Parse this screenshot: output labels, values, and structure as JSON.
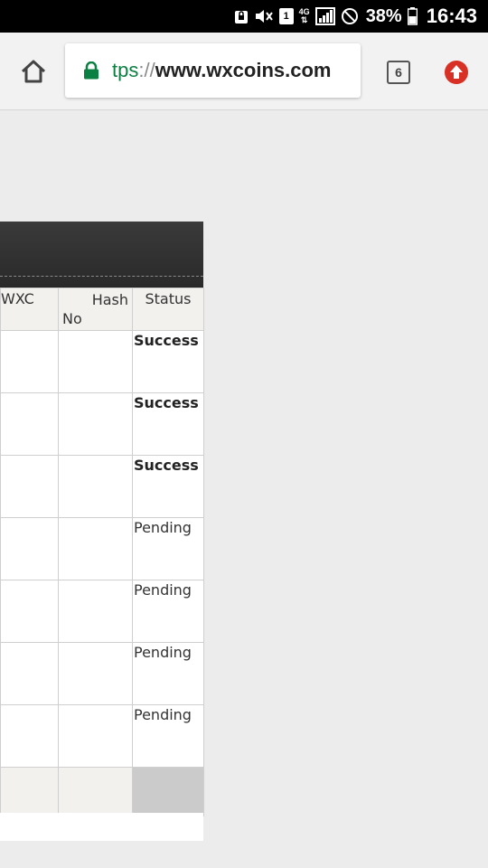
{
  "status_bar": {
    "network": "4G",
    "sim_slot": "1",
    "battery_percent": "38%",
    "time": "16:43",
    "icons": [
      "lock-notification-icon",
      "mute-icon",
      "sim-icon",
      "signal-icon",
      "do-not-disturb-icon",
      "battery-icon"
    ]
  },
  "browser": {
    "url_scheme": "tps",
    "url_separator": "://",
    "url_host": "www.wxcoins.com",
    "tab_count": "6",
    "accent_color": "#0b8043",
    "update_color": "#d93025"
  },
  "table": {
    "headers": {
      "wxc": "WXC",
      "hash_line1": "Hash",
      "hash_line2": "No",
      "status": "Status"
    },
    "rows": [
      {
        "status": "Success"
      },
      {
        "status": "Success"
      },
      {
        "status": "Success"
      },
      {
        "status": "Pending"
      },
      {
        "status": "Pending"
      },
      {
        "status": "Pending"
      },
      {
        "status": "Pending"
      }
    ]
  }
}
